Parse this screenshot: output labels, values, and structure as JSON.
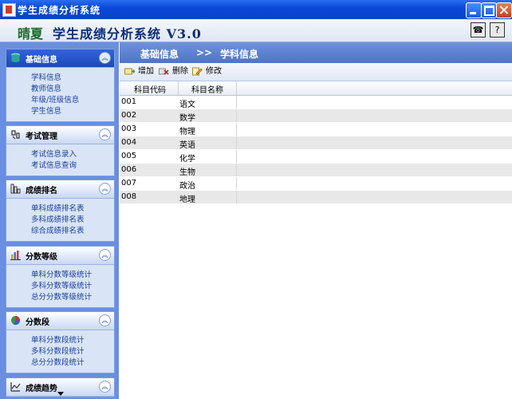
{
  "window": {
    "title": "学生成绩分析系统"
  },
  "header": {
    "brand_prefix": "晴夏",
    "brand_title": "学生成绩分析系统  V3.0",
    "phone_glyph": "☎",
    "help_glyph": "?"
  },
  "sidebar": {
    "panels": [
      {
        "title": "基础信息",
        "icon": "database-icon",
        "links": [
          "学科信息",
          "教师信息",
          "年级/班级信息",
          "学生信息"
        ]
      },
      {
        "title": "考试管理",
        "icon": "exam-icon",
        "links": [
          "考试信息录入",
          "考试信息查询"
        ]
      },
      {
        "title": "成绩排名",
        "icon": "ranking-icon",
        "links": [
          "单科成绩排名表",
          "多科成绩排名表",
          "综合成绩排名表"
        ]
      },
      {
        "title": "分数等级",
        "icon": "bar-chart-icon",
        "links": [
          "单科分数等级统计",
          "多科分数等级统计",
          "总分分数等级统计"
        ]
      },
      {
        "title": "分数段",
        "icon": "pie-chart-icon",
        "links": [
          "单科分数段统计",
          "多科分数段统计",
          "总分分数段统计"
        ]
      },
      {
        "title": "成绩趋势",
        "icon": "trend-icon",
        "links": []
      }
    ],
    "collapse_glyph": "︽"
  },
  "breadcrumb": {
    "section": "基础信息",
    "separator": ">>",
    "page": "学科信息"
  },
  "toolbar": {
    "add": "增加",
    "delete": "删除",
    "edit": "修改"
  },
  "table": {
    "headers": [
      "科目代码",
      "科目名称"
    ],
    "rows": [
      [
        "001",
        "语文"
      ],
      [
        "002",
        "数学"
      ],
      [
        "003",
        "物理"
      ],
      [
        "004",
        "英语"
      ],
      [
        "005",
        "化学"
      ],
      [
        "006",
        "生物"
      ],
      [
        "007",
        "政治"
      ],
      [
        "008",
        "地理"
      ]
    ]
  },
  "colors": {
    "titlebar": "#0a49d8",
    "sidebar_bg": "#6a8ee0",
    "active_panel": "#1a49b8",
    "link": "#1a3f9c",
    "brand_green": "#1c6b2a",
    "brand_blue": "#0b2c77"
  }
}
